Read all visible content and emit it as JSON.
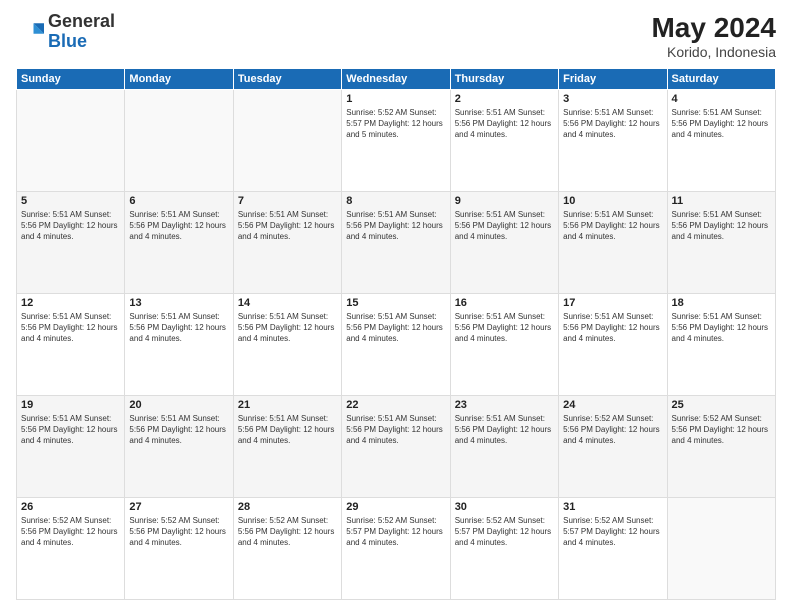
{
  "header": {
    "logo": {
      "general": "General",
      "blue": "Blue"
    },
    "title": "May 2024",
    "location": "Korido, Indonesia"
  },
  "weekdays": [
    "Sunday",
    "Monday",
    "Tuesday",
    "Wednesday",
    "Thursday",
    "Friday",
    "Saturday"
  ],
  "weeks": [
    [
      {
        "day": null,
        "info": null
      },
      {
        "day": null,
        "info": null
      },
      {
        "day": null,
        "info": null
      },
      {
        "day": "1",
        "info": "Sunrise: 5:52 AM\nSunset: 5:57 PM\nDaylight: 12 hours\nand 5 minutes."
      },
      {
        "day": "2",
        "info": "Sunrise: 5:51 AM\nSunset: 5:56 PM\nDaylight: 12 hours\nand 4 minutes."
      },
      {
        "day": "3",
        "info": "Sunrise: 5:51 AM\nSunset: 5:56 PM\nDaylight: 12 hours\nand 4 minutes."
      },
      {
        "day": "4",
        "info": "Sunrise: 5:51 AM\nSunset: 5:56 PM\nDaylight: 12 hours\nand 4 minutes."
      }
    ],
    [
      {
        "day": "5",
        "info": "Sunrise: 5:51 AM\nSunset: 5:56 PM\nDaylight: 12 hours\nand 4 minutes."
      },
      {
        "day": "6",
        "info": "Sunrise: 5:51 AM\nSunset: 5:56 PM\nDaylight: 12 hours\nand 4 minutes."
      },
      {
        "day": "7",
        "info": "Sunrise: 5:51 AM\nSunset: 5:56 PM\nDaylight: 12 hours\nand 4 minutes."
      },
      {
        "day": "8",
        "info": "Sunrise: 5:51 AM\nSunset: 5:56 PM\nDaylight: 12 hours\nand 4 minutes."
      },
      {
        "day": "9",
        "info": "Sunrise: 5:51 AM\nSunset: 5:56 PM\nDaylight: 12 hours\nand 4 minutes."
      },
      {
        "day": "10",
        "info": "Sunrise: 5:51 AM\nSunset: 5:56 PM\nDaylight: 12 hours\nand 4 minutes."
      },
      {
        "day": "11",
        "info": "Sunrise: 5:51 AM\nSunset: 5:56 PM\nDaylight: 12 hours\nand 4 minutes."
      }
    ],
    [
      {
        "day": "12",
        "info": "Sunrise: 5:51 AM\nSunset: 5:56 PM\nDaylight: 12 hours\nand 4 minutes."
      },
      {
        "day": "13",
        "info": "Sunrise: 5:51 AM\nSunset: 5:56 PM\nDaylight: 12 hours\nand 4 minutes."
      },
      {
        "day": "14",
        "info": "Sunrise: 5:51 AM\nSunset: 5:56 PM\nDaylight: 12 hours\nand 4 minutes."
      },
      {
        "day": "15",
        "info": "Sunrise: 5:51 AM\nSunset: 5:56 PM\nDaylight: 12 hours\nand 4 minutes."
      },
      {
        "day": "16",
        "info": "Sunrise: 5:51 AM\nSunset: 5:56 PM\nDaylight: 12 hours\nand 4 minutes."
      },
      {
        "day": "17",
        "info": "Sunrise: 5:51 AM\nSunset: 5:56 PM\nDaylight: 12 hours\nand 4 minutes."
      },
      {
        "day": "18",
        "info": "Sunrise: 5:51 AM\nSunset: 5:56 PM\nDaylight: 12 hours\nand 4 minutes."
      }
    ],
    [
      {
        "day": "19",
        "info": "Sunrise: 5:51 AM\nSunset: 5:56 PM\nDaylight: 12 hours\nand 4 minutes."
      },
      {
        "day": "20",
        "info": "Sunrise: 5:51 AM\nSunset: 5:56 PM\nDaylight: 12 hours\nand 4 minutes."
      },
      {
        "day": "21",
        "info": "Sunrise: 5:51 AM\nSunset: 5:56 PM\nDaylight: 12 hours\nand 4 minutes."
      },
      {
        "day": "22",
        "info": "Sunrise: 5:51 AM\nSunset: 5:56 PM\nDaylight: 12 hours\nand 4 minutes."
      },
      {
        "day": "23",
        "info": "Sunrise: 5:51 AM\nSunset: 5:56 PM\nDaylight: 12 hours\nand 4 minutes."
      },
      {
        "day": "24",
        "info": "Sunrise: 5:52 AM\nSunset: 5:56 PM\nDaylight: 12 hours\nand 4 minutes."
      },
      {
        "day": "25",
        "info": "Sunrise: 5:52 AM\nSunset: 5:56 PM\nDaylight: 12 hours\nand 4 minutes."
      }
    ],
    [
      {
        "day": "26",
        "info": "Sunrise: 5:52 AM\nSunset: 5:56 PM\nDaylight: 12 hours\nand 4 minutes."
      },
      {
        "day": "27",
        "info": "Sunrise: 5:52 AM\nSunset: 5:56 PM\nDaylight: 12 hours\nand 4 minutes."
      },
      {
        "day": "28",
        "info": "Sunrise: 5:52 AM\nSunset: 5:56 PM\nDaylight: 12 hours\nand 4 minutes."
      },
      {
        "day": "29",
        "info": "Sunrise: 5:52 AM\nSunset: 5:57 PM\nDaylight: 12 hours\nand 4 minutes."
      },
      {
        "day": "30",
        "info": "Sunrise: 5:52 AM\nSunset: 5:57 PM\nDaylight: 12 hours\nand 4 minutes."
      },
      {
        "day": "31",
        "info": "Sunrise: 5:52 AM\nSunset: 5:57 PM\nDaylight: 12 hours\nand 4 minutes."
      },
      {
        "day": null,
        "info": null
      }
    ]
  ]
}
